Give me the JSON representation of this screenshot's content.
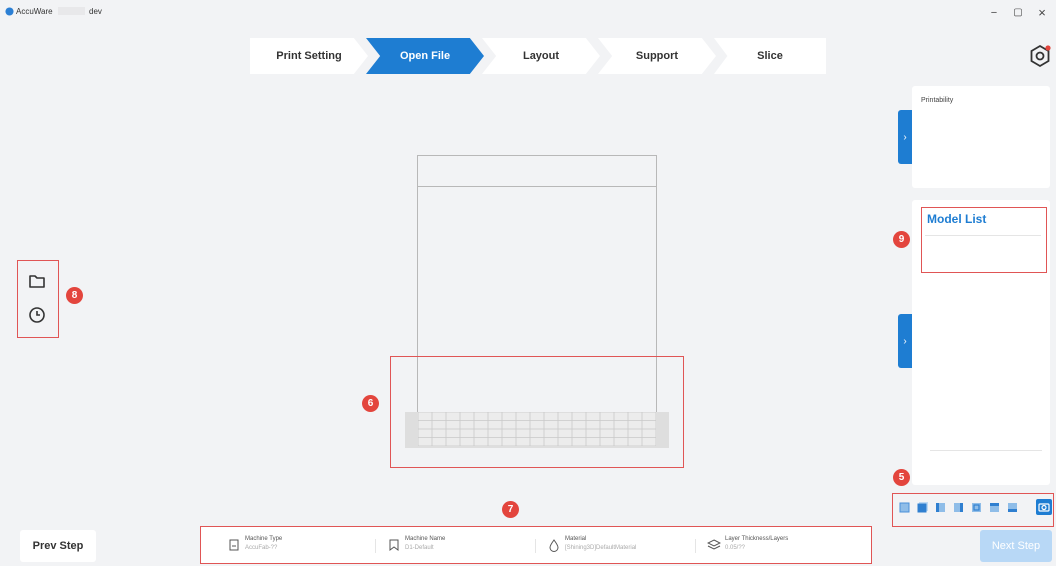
{
  "window": {
    "app_name": "AccuWare",
    "env": "dev",
    "minimize": "−",
    "maximize": "▢",
    "close": "×"
  },
  "steps": [
    {
      "label": "Print Setting",
      "active": false
    },
    {
      "label": "Open File",
      "active": true
    },
    {
      "label": "Layout",
      "active": false
    },
    {
      "label": "Support",
      "active": false
    },
    {
      "label": "Slice",
      "active": false
    }
  ],
  "left_tools": {
    "open_file_icon": "folder-icon",
    "history_icon": "clock-icon"
  },
  "right_panel": {
    "printability_title": "Printability",
    "model_list_title": "Model List",
    "collapse_glyph": "›"
  },
  "view_buttons": [
    "view-front-icon",
    "view-back-icon",
    "view-left-icon",
    "view-right-icon",
    "view-top-icon",
    "view-bottom-icon",
    "view-iso-icon",
    "camera-icon"
  ],
  "info_bar": [
    {
      "label": "Machine Type",
      "value": "AccuFab-??"
    },
    {
      "label": "Machine Name",
      "value": "D1-Default"
    },
    {
      "label": "Material",
      "value": "[Shining3D]DefaultMaterial"
    },
    {
      "label": "Layer Thickness/Layers",
      "value": "0.05/??"
    }
  ],
  "buttons": {
    "prev": "Prev Step",
    "next": "Next Step"
  },
  "badges": {
    "b5": "5",
    "b6": "6",
    "b7": "7",
    "b8": "8",
    "b9": "9"
  },
  "colors": {
    "accent": "#1e7dd2",
    "annotation": "#e05555",
    "badge": "#e3453d"
  }
}
